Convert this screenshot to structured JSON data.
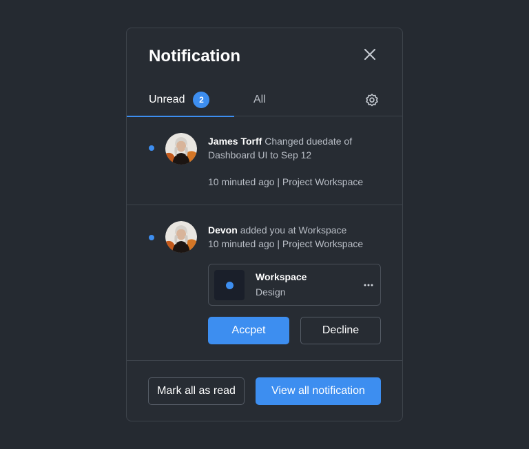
{
  "header": {
    "title": "Notification"
  },
  "tabs": [
    {
      "label": "Unread",
      "badge": "2"
    },
    {
      "label": "All"
    }
  ],
  "notifications": [
    {
      "user": "James Torff",
      "message": "Changed duedate of Dashboard UI to Sep 12",
      "meta": "10 minuted ago | Project Workspace"
    },
    {
      "user": "Devon",
      "message": "added you at Workspace",
      "meta": "10 minuted ago | Project Workspace",
      "workspace": {
        "title": "Workspace",
        "subtitle": "Design"
      },
      "accept_label": "Accpet",
      "decline_label": "Decline"
    }
  ],
  "footer": {
    "mark_read_label": "Mark all as read",
    "view_all_label": "View all notification"
  },
  "colors": {
    "accent": "#3d8ef0",
    "background": "#252a31",
    "panel": "#272c33"
  },
  "icons": [
    "close-icon",
    "gear-icon",
    "more-horizontal-icon"
  ]
}
